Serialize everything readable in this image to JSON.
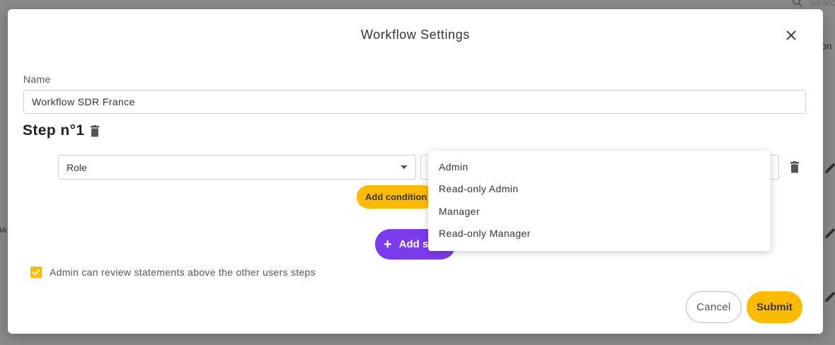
{
  "background": {
    "search_placeholder": "Searc",
    "fragment_right": "on",
    "fragment_left": "IA"
  },
  "modal": {
    "title": "Workflow Settings",
    "name_label": "Name",
    "name_value": "Workflow SDR France",
    "step_title": "Step n°1",
    "condition": {
      "field_value": "Role",
      "add_condition_label": "Add condition"
    },
    "add_step_label": "Add step",
    "checkbox_checked": true,
    "checkbox_label": "Admin can review statements above the other users steps",
    "cancel_label": "Cancel",
    "submit_label": "Submit"
  },
  "dropdown": {
    "options": [
      "Admin",
      "Read-only Admin",
      "Manager",
      "Read-only Manager"
    ]
  },
  "colors": {
    "accent_yellow": "#ffbb00",
    "accent_purple": "#7c3aed",
    "overlay": "#8a8a8a"
  }
}
